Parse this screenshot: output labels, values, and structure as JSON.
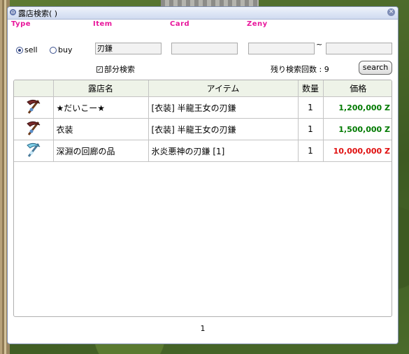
{
  "window": {
    "title": "露店検索( )"
  },
  "labels": {
    "type": "Type",
    "item": "Item",
    "card": "Card",
    "zeny": "Zeny"
  },
  "type_options": {
    "sell": "sell",
    "buy": "buy",
    "selected": "sell"
  },
  "inputs": {
    "item": "刃鎌",
    "card": "",
    "zeny_min": "",
    "zeny_max": "",
    "zeny_separator": "~"
  },
  "partial_search": {
    "label": "部分検索",
    "checked": true
  },
  "remaining_searches": "残り検索回数 : 9",
  "search_button": "search",
  "table": {
    "headers": [
      "",
      "露店名",
      "アイテム",
      "数量",
      "価格"
    ],
    "rows": [
      {
        "icon": "scythe-icon",
        "shop": "★だいこー★",
        "item": "[衣装] 半龍王女の刃鎌",
        "qty": "1",
        "price": "1,200,000 Z",
        "price_color": "#007a00"
      },
      {
        "icon": "scythe-icon",
        "shop": "衣装",
        "item": "[衣装] 半龍王女の刃鎌",
        "qty": "1",
        "price": "1,500,000 Z",
        "price_color": "#007a00"
      },
      {
        "icon": "ice-scythe-icon",
        "shop": "深淵の回廊の品",
        "item": "氷炎悪神の刃鎌 [1]",
        "qty": "1",
        "price": "10,000,000 Z",
        "price_color": "#e01010"
      }
    ]
  },
  "page_number": "1"
}
